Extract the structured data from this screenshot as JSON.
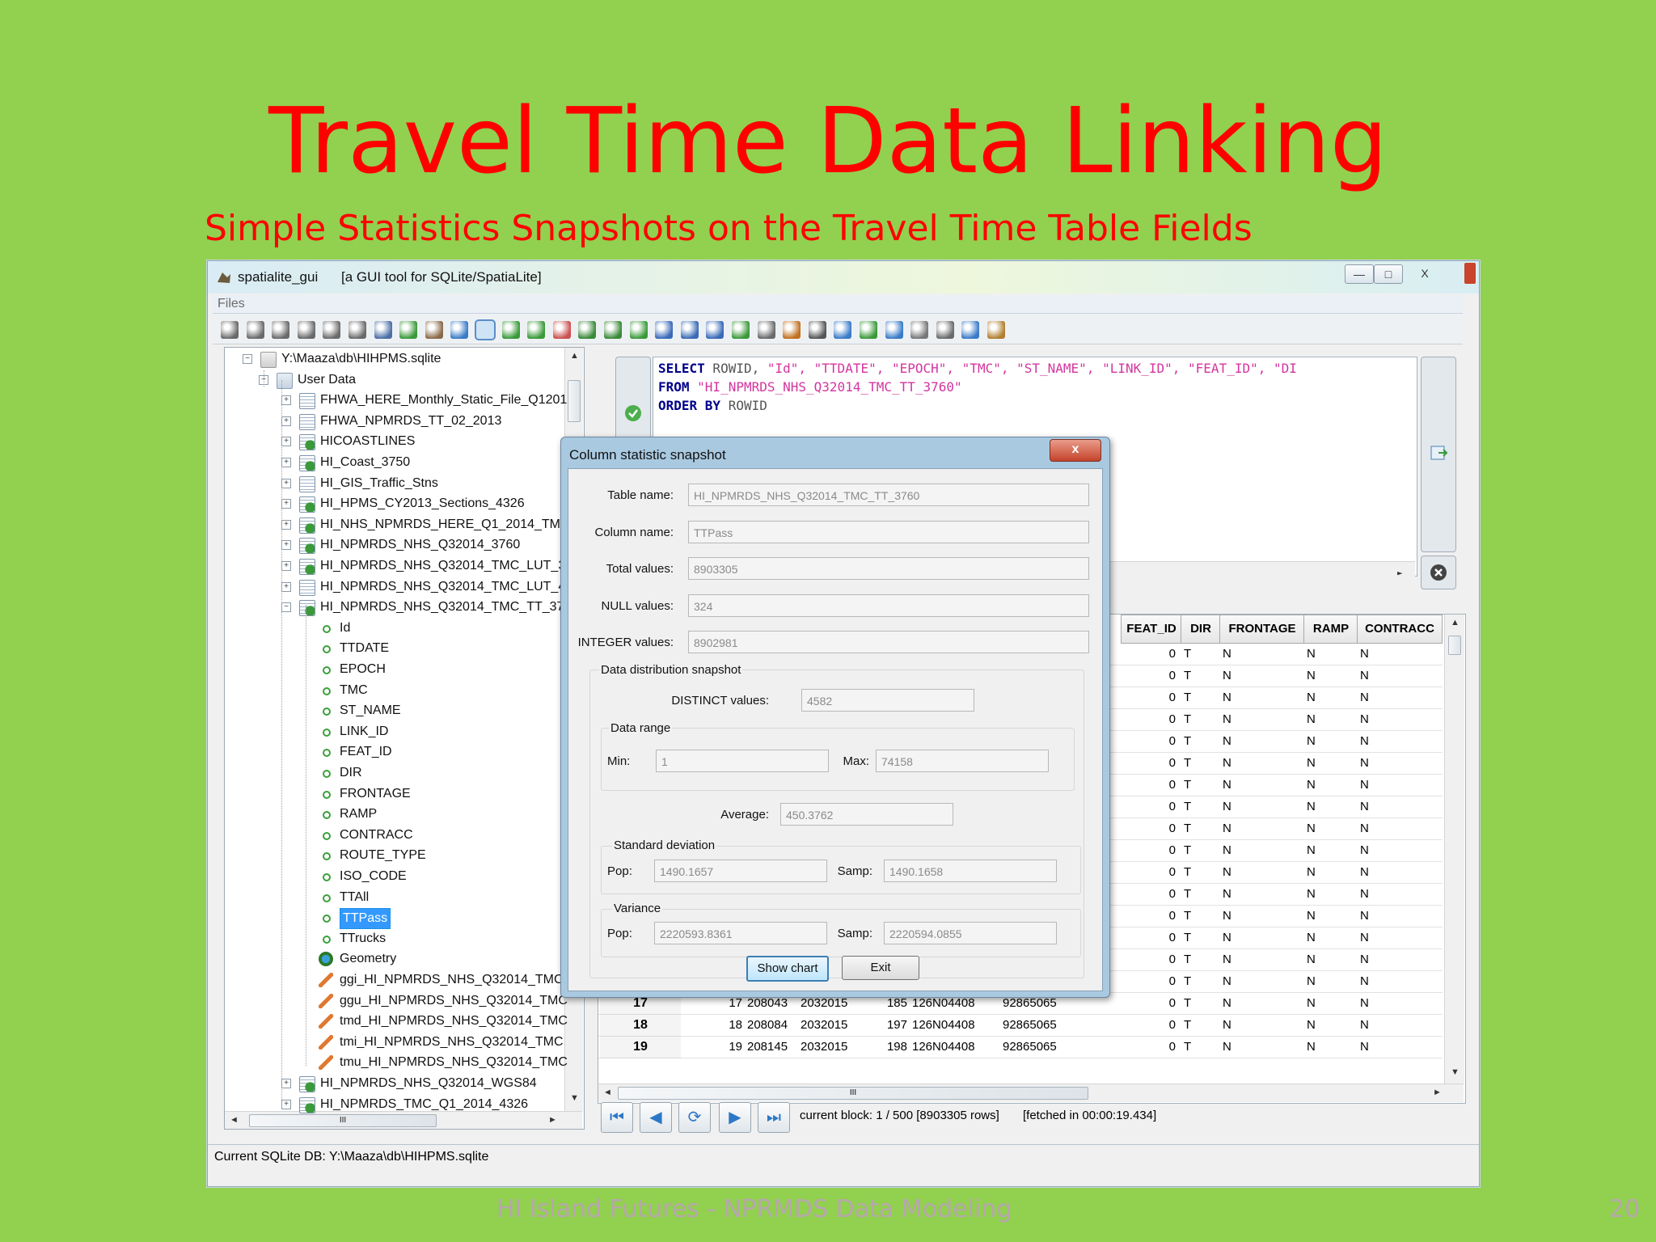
{
  "slide": {
    "title": "Travel Time Data Linking",
    "subtitle": "Simple Statistics Snapshots on the Travel Time Table Fields",
    "footer": "HI Island Futures - NPRMDS Data Modeling",
    "page_number": "20"
  },
  "app": {
    "name": "spatialite_gui",
    "tagline": "[a GUI tool for SQLite/SpatiaLite]",
    "window_buttons": [
      "—",
      "□",
      "X"
    ],
    "menu": [
      "Files"
    ]
  },
  "toolbar_icons": [
    "connect-icon",
    "disconnect-icon",
    "create-db-icon",
    "memory-db-icon",
    "memory-load-icon",
    "memory-save-icon",
    "vacuum-icon",
    "sql-script-icon",
    "load-shp-icon",
    "virtual-shp-icon",
    "query-icon",
    "map-icon",
    "checkgeom-icon",
    "csv-icon",
    "txt-icon",
    "dbf-icon",
    "xls-icon",
    "load-xml-icon",
    "wfs-icon",
    "dxf-icon",
    "network-icon",
    "exif-icon",
    "gps-icon",
    "srid-icon",
    "charset-icon",
    "attach-icon",
    "sql-log-icon",
    "color-icon",
    "help-icon",
    "about-icon",
    "exit-icon"
  ],
  "tree": {
    "root": "Y:\\Maaza\\db\\HIHPMS.sqlite",
    "user_data": "User Data",
    "tables": [
      "FHWA_HERE_Monthly_Static_File_Q1201",
      "FHWA_NPMRDS_TT_02_2013",
      "HICOASTLINES",
      "HI_Coast_3750",
      "HI_GIS_Traffic_Stns",
      "HI_HPMS_CY2013_Sections_4326",
      "HI_NHS_NPMRDS_HERE_Q1_2014_TMC_",
      "HI_NPMRDS_NHS_Q32014_3760",
      "HI_NPMRDS_NHS_Q32014_TMC_LUT_37",
      "HI_NPMRDS_NHS_Q32014_TMC_LUT_43",
      "HI_NPMRDS_NHS_Q32014_TMC_TT_376"
    ],
    "columns": [
      "Id",
      "TTDATE",
      "EPOCH",
      "TMC",
      "ST_NAME",
      "LINK_ID",
      "FEAT_ID",
      "DIR",
      "FRONTAGE",
      "RAMP",
      "CONTRACC",
      "ROUTE_TYPE",
      "ISO_CODE",
      "TTAll",
      "TTPass",
      "TTrucks"
    ],
    "selected_column": "TTPass",
    "geometry": "Geometry",
    "triggers": [
      "ggi_HI_NPMRDS_NHS_Q32014_TMC",
      "ggu_HI_NPMRDS_NHS_Q32014_TMC",
      "tmd_HI_NPMRDS_NHS_Q32014_TMC",
      "tmi_HI_NPMRDS_NHS_Q32014_TMC",
      "tmu_HI_NPMRDS_NHS_Q32014_TMC"
    ],
    "more_tables": [
      "HI_NPMRDS_NHS_Q32014_WGS84",
      "HI_NPMRDS_TMC_Q1_2014_4326"
    ],
    "hscroll_grip": "III"
  },
  "sql": {
    "line1_kw": "SELECT",
    "line1_plain": " ROWID, ",
    "line1_str": "\"Id\", \"TTDATE\", \"EPOCH\", \"TMC\", \"ST_NAME\", \"LINK_ID\", \"FEAT_ID\", \"DI",
    "line2_kw": "FROM",
    "line2_str": " \"HI_NPMRDS_NHS_Q32014_TMC_TT_3760\"",
    "line3_kw": "ORDER BY",
    "line3_plain": " ROWID"
  },
  "grid": {
    "columns_visible": [
      "FEAT_ID",
      "DIR",
      "FRONTAGE",
      "RAMP",
      "CONTRACC"
    ],
    "right_rows": [
      [
        "0",
        "T",
        "N",
        "N",
        "N"
      ],
      [
        "0",
        "T",
        "N",
        "N",
        "N"
      ],
      [
        "0",
        "T",
        "N",
        "N",
        "N"
      ],
      [
        "0",
        "T",
        "N",
        "N",
        "N"
      ],
      [
        "0",
        "T",
        "N",
        "N",
        "N"
      ],
      [
        "0",
        "T",
        "N",
        "N",
        "N"
      ],
      [
        "0",
        "T",
        "N",
        "N",
        "N"
      ],
      [
        "0",
        "T",
        "N",
        "N",
        "N"
      ],
      [
        "0",
        "T",
        "N",
        "N",
        "N"
      ],
      [
        "0",
        "T",
        "N",
        "N",
        "N"
      ],
      [
        "0",
        "T",
        "N",
        "N",
        "N"
      ],
      [
        "0",
        "T",
        "N",
        "N",
        "N"
      ],
      [
        "0",
        "T",
        "N",
        "N",
        "N"
      ],
      [
        "0",
        "T",
        "N",
        "N",
        "N"
      ],
      [
        "0",
        "T",
        "N",
        "N",
        "N"
      ],
      [
        "0",
        "T",
        "N",
        "N",
        "N"
      ],
      [
        "0",
        "T",
        "N",
        "N",
        "N"
      ],
      [
        "0",
        "T",
        "N",
        "N",
        "N"
      ],
      [
        "0",
        "T",
        "N",
        "N",
        "N"
      ]
    ],
    "bottom_rows": [
      {
        "row": "17",
        "id": "17",
        "ttdate": "208043",
        "epoch": "2032015",
        "tmc_num": "185",
        "tmc": "126N04408",
        "link": "92865065"
      },
      {
        "row": "18",
        "id": "18",
        "ttdate": "208084",
        "epoch": "2032015",
        "tmc_num": "197",
        "tmc": "126N04408",
        "link": "92865065"
      },
      {
        "row": "19",
        "id": "19",
        "ttdate": "208145",
        "epoch": "2032015",
        "tmc_num": "198",
        "tmc": "126N04408",
        "link": "92865065"
      }
    ],
    "hscroll_grip": "III"
  },
  "navigation": {
    "block_info": "current block: 1 / 500 [8903305 rows]",
    "fetch_info": "[fetched in 00:00:19.434]"
  },
  "status": "Current SQLite DB: Y:\\Maaza\\db\\HIHPMS.sqlite",
  "dialog": {
    "title": "Column statistic snapshot",
    "close": "x",
    "table_label": "Table name:",
    "table_value": "HI_NPMRDS_NHS_Q32014_TMC_TT_3760",
    "column_label": "Column name:",
    "column_value": "TTPass",
    "total_label": "Total values:",
    "total_value": "8903305",
    "null_label": "NULL values:",
    "null_value": "324",
    "integer_label": "INTEGER values:",
    "integer_value": "8902981",
    "dist_group": "Data distribution snapshot",
    "distinct_label": "DISTINCT values:",
    "distinct_value": "4582",
    "range_group": "Data range",
    "min_label": "Min:",
    "min_value": "1",
    "max_label": "Max:",
    "max_value": "74158",
    "avg_label": "Average:",
    "avg_value": "450.3762",
    "stddev_group": "Standard deviation",
    "pop_label": "Pop:",
    "samp_label": "Samp:",
    "stddev_pop": "1490.1657",
    "stddev_samp": "1490.1658",
    "variance_group": "Variance",
    "var_pop": "2220593.8361",
    "var_samp": "2220594.0855",
    "show_chart": "Show chart",
    "exit": "Exit"
  }
}
